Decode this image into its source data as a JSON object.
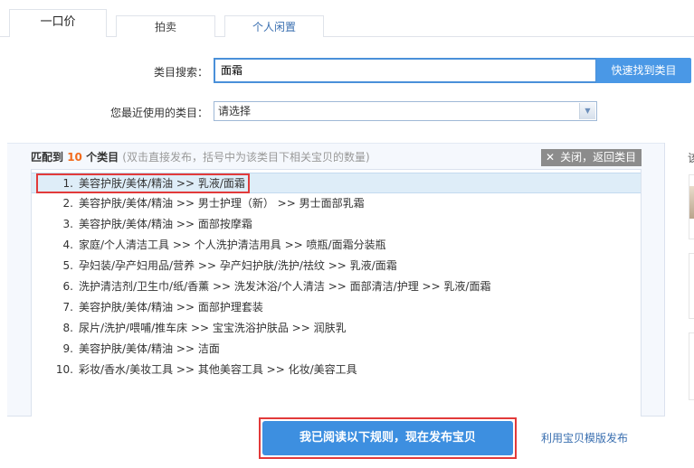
{
  "tabs": [
    {
      "label": "一口价"
    },
    {
      "label": "拍卖"
    },
    {
      "label": "个人闲置"
    }
  ],
  "search": {
    "label": "类目搜索：",
    "value": "面霜",
    "button": "快速找到类目"
  },
  "recent": {
    "label": "您最近使用的类目：",
    "value": "请选择"
  },
  "results": {
    "prefix": "匹配到",
    "count": "10",
    "suffix": "个类目",
    "hint": "(双击直接发布，括号中为该类目下相关宝贝的数量)",
    "close_label": "关闭，返回类目",
    "items": [
      {
        "n": "1.",
        "path": "美容护肤/美体/精油 >> 乳液/面霜"
      },
      {
        "n": "2.",
        "path": "美容护肤/美体/精油 >> 男士护理（新） >> 男士面部乳霜"
      },
      {
        "n": "3.",
        "path": "美容护肤/美体/精油 >> 面部按摩霜"
      },
      {
        "n": "4.",
        "path": "家庭/个人清洁工具 >> 个人洗护清洁用具 >> 喷瓶/面霜分装瓶"
      },
      {
        "n": "5.",
        "path": "孕妇装/孕产妇用品/营养 >> 孕产妇护肤/洗护/祛纹 >> 乳液/面霜"
      },
      {
        "n": "6.",
        "path": "洗护清洁剂/卫生巾/纸/香薰 >> 洗发沐浴/个人清洁 >> 面部清洁/护理 >> 乳液/面霜"
      },
      {
        "n": "7.",
        "path": "美容护肤/美体/精油 >> 面部护理套装"
      },
      {
        "n": "8.",
        "path": "尿片/洗护/喂哺/推车床 >> 宝宝洗浴护肤品 >> 润肤乳"
      },
      {
        "n": "9.",
        "path": "美容护肤/美体/精油 >> 洁面"
      },
      {
        "n": "10.",
        "path": "彩妆/香水/美妆工具 >> 其他美容工具 >> 化妆/美容工具"
      }
    ]
  },
  "right_panel": {
    "title_partial": "该"
  },
  "actions": {
    "publish": "我已阅读以下规则，现在发布宝贝",
    "template_link": "利用宝贝模版发布"
  },
  "colors": {
    "accent": "#3d8fe0",
    "highlight": "#e23a3a",
    "count": "#f26b1d"
  }
}
